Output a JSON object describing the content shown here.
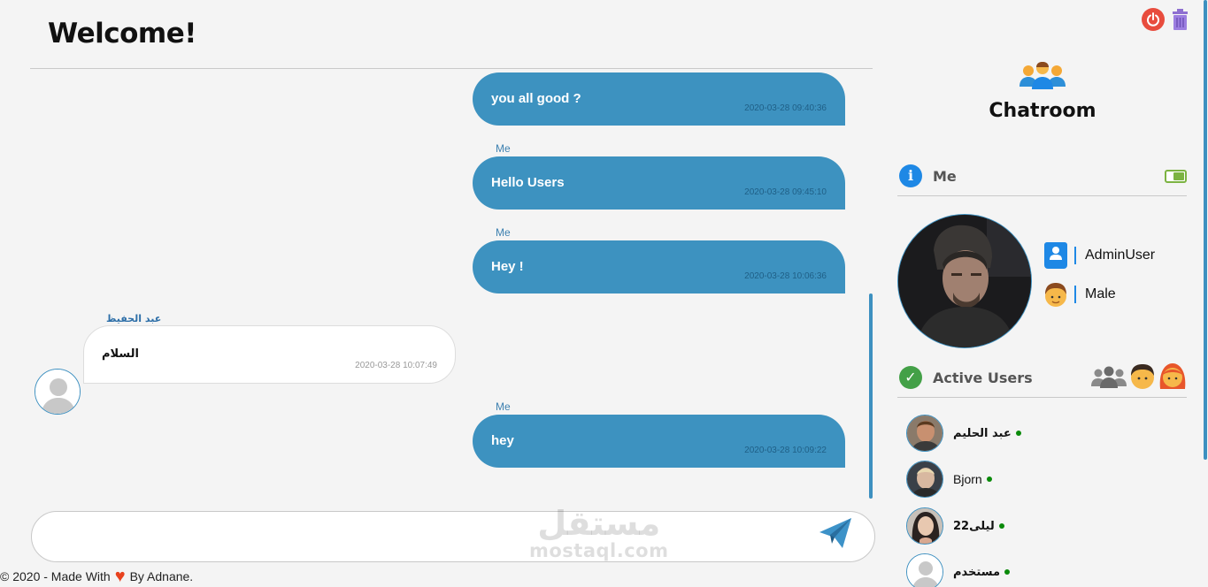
{
  "header": {
    "title": "Welcome!"
  },
  "top_actions": {
    "power_icon": "power-icon",
    "trash_icon": "trash-icon"
  },
  "messages": [
    {
      "sender": "Me",
      "mine": true,
      "text": "you all good ?",
      "time": "2020-03-28 09:40:36",
      "show_sender": false
    },
    {
      "sender": "Me",
      "mine": true,
      "text": "Hello Users",
      "time": "2020-03-28 09:45:10",
      "show_sender": true
    },
    {
      "sender": "Me",
      "mine": true,
      "text": "Hey !",
      "time": "2020-03-28 10:06:36",
      "show_sender": true
    },
    {
      "sender": "عبد الحفيظ",
      "mine": false,
      "text": "السلام",
      "time": "2020-03-28 10:07:49",
      "show_sender": true
    },
    {
      "sender": "Me",
      "mine": true,
      "text": "hey",
      "time": "2020-03-28 10:09:22",
      "show_sender": true
    }
  ],
  "composer": {
    "value": "",
    "placeholder": "",
    "send_icon": "paper-plane-icon"
  },
  "watermark": {
    "arabic": "مستقل",
    "latin": "mostaql.com"
  },
  "footer": {
    "prefix": "© 2020 - Made With",
    "suffix": "By Adnane."
  },
  "sidebar": {
    "room_title": "Chatroom",
    "me_section": {
      "label": "Me",
      "icon": "info-icon",
      "toggle_icon": "toggle-icon"
    },
    "profile": {
      "username": "AdminUser",
      "gender": "Male"
    },
    "active_section": {
      "label": "Active Users",
      "icon": "check-circle-icon"
    },
    "active_users": [
      {
        "name": "عبد الحليم",
        "arabic": true
      },
      {
        "name": "Bjorn",
        "arabic": false
      },
      {
        "name": "ليلى22",
        "arabic": true
      },
      {
        "name": "مستخدم",
        "arabic": true
      }
    ]
  },
  "colors": {
    "accent": "#3d92c0",
    "online": "#0a8a0a",
    "power": "#e84c3d",
    "heart": "#e8421e"
  }
}
